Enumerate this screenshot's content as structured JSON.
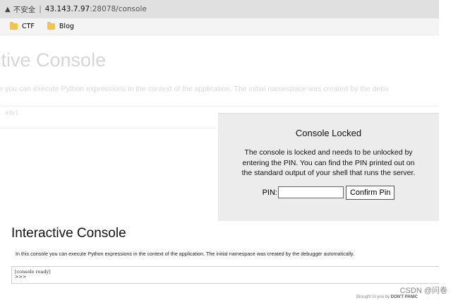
{
  "browser": {
    "insecure_label": "不安全",
    "separator": "|",
    "url_host": "43.143.7.97",
    "url_path": ":28078/console",
    "bookmarks": [
      {
        "label": "CTF"
      },
      {
        "label": "Blog"
      }
    ]
  },
  "background_page": {
    "title": "ractive Console",
    "description": "sole you can execute Python expressions in the context of the application. The initial namespace was created by the debu",
    "console_text": "ady]"
  },
  "modal": {
    "title": "Console Locked",
    "message": "The console is locked and needs to be unlocked by entering the PIN. You can find the PIN printed out on the standard output of your shell that runs the server.",
    "pin_label": "PIN:",
    "pin_value": "",
    "confirm_label": "Confirm Pin"
  },
  "console": {
    "title": "Interactive Console",
    "description": "In this console you can execute Python expressions in the context of the application. The initial namespace was created by the debugger automatically.",
    "line1": "[console ready]",
    "prompt": ">>>"
  },
  "watermark": "CSDN @问卷",
  "footer": {
    "prefix": "Brought to you by",
    "brand": "DON'T PANIC"
  }
}
